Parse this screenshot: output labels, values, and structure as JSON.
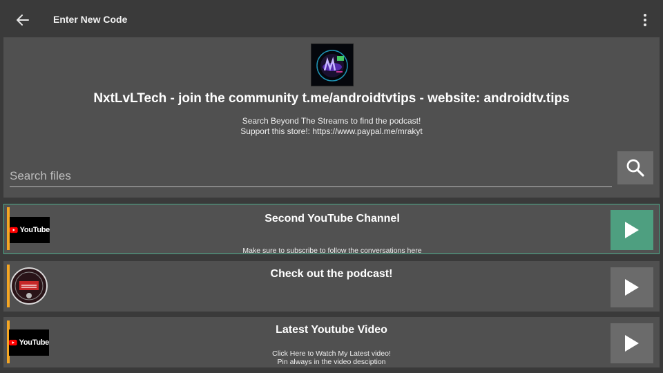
{
  "header": {
    "title": "Enter New Code",
    "back_icon": "arrow-left-icon",
    "menu_icon": "more-vert-icon"
  },
  "store": {
    "title": "NxtLvLTech - join the community t.me/androidtvtips - website: androidtv.tips",
    "description_line1": "Search Beyond The Streams to find the podcast!",
    "description_line2": "Support this store!: https://www.paypal.me/mrakyt"
  },
  "search": {
    "placeholder": "Search files",
    "value": "",
    "icon": "search-icon"
  },
  "items": [
    {
      "title": "Second YouTube Channel",
      "desc_line1": "Make sure to subscribe to follow the conversations here",
      "desc_line2": "",
      "thumb_text": "YouTube",
      "selected": true
    },
    {
      "title": "Check out the podcast!",
      "desc_line1": "",
      "desc_line2": "",
      "thumb_text": "",
      "selected": false
    },
    {
      "title": "Latest Youtube Video",
      "desc_line1": "Click Here to Watch My Latest video!",
      "desc_line2": "Pin always in the video desciption",
      "thumb_text": "YouTube",
      "selected": false
    }
  ],
  "colors": {
    "background": "#3a3a3a",
    "panel": "#505050",
    "accent_orange": "#f5a623",
    "selected_green": "#4e9f80",
    "button_gray": "#6b6b6b"
  }
}
